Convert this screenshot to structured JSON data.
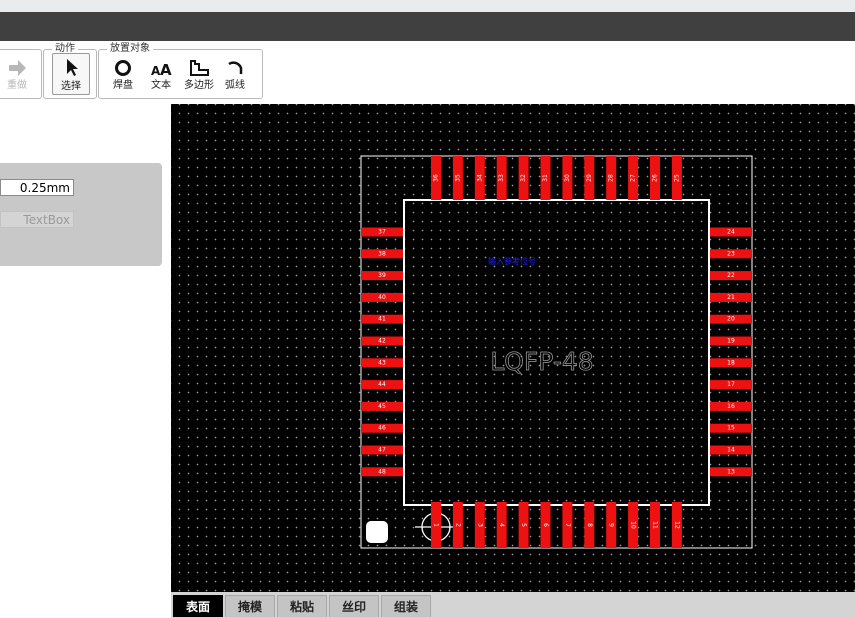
{
  "toolbar": {
    "redo_label": "重做",
    "group_action_title": "动作",
    "select_label": "选择",
    "group_place_title": "放置对象",
    "pad_label": "焊盘",
    "text_label": "文本",
    "polygon_label": "多边形",
    "arc_label": "弧线"
  },
  "properties": {
    "line_width_value": "0.25mm",
    "text_placeholder": "TextBox"
  },
  "canvas": {
    "component_name": "LQFP-48",
    "overlay_text": "输入参考位号",
    "colors": {
      "pad": "#ee1111",
      "outline": "#ffffff",
      "grid": "#9a9a9a",
      "label": "#2222ff"
    },
    "pins_top": [
      "36",
      "35",
      "34",
      "33",
      "32",
      "31",
      "30",
      "29",
      "28",
      "27",
      "26",
      "25"
    ],
    "pins_left": [
      "37",
      "38",
      "39",
      "40",
      "41",
      "42",
      "43",
      "44",
      "45",
      "46",
      "47",
      "48"
    ],
    "pins_right": [
      "24",
      "23",
      "22",
      "21",
      "20",
      "19",
      "18",
      "17",
      "16",
      "15",
      "14",
      "13"
    ],
    "pins_bottom": [
      "1",
      "2",
      "3",
      "4",
      "5",
      "6",
      "7",
      "8",
      "9",
      "10",
      "11",
      "12"
    ]
  },
  "tabs": [
    {
      "label": "表面",
      "active": true
    },
    {
      "label": "掩模",
      "active": false
    },
    {
      "label": "粘贴",
      "active": false
    },
    {
      "label": "丝印",
      "active": false
    },
    {
      "label": "组装",
      "active": false
    }
  ]
}
